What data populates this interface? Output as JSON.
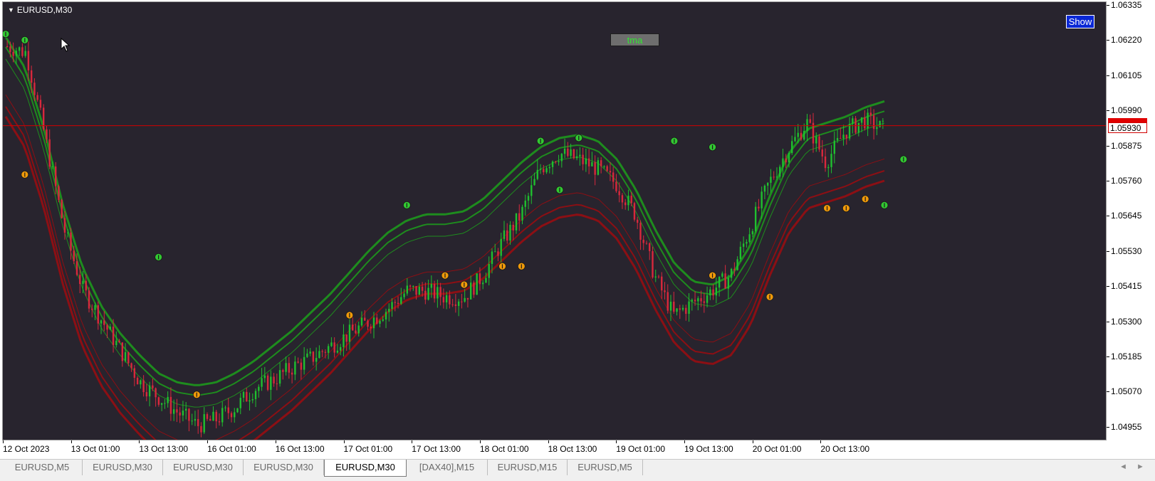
{
  "chart": {
    "symbol": "EURUSD,M30",
    "buttons": {
      "tma": "tma",
      "show": "Show"
    },
    "bid_price": "1.05930",
    "price_labels": [
      "1.06335",
      "1.06220",
      "1.06105",
      "1.05990",
      "1.05875",
      "1.05760",
      "1.05645",
      "1.05530",
      "1.05415",
      "1.05300",
      "1.05185",
      "1.05070",
      "1.04955"
    ],
    "time_labels": [
      "12 Oct 2023",
      "13 Oct 01:00",
      "13 Oct 13:00",
      "16 Oct 01:00",
      "16 Oct 13:00",
      "17 Oct 01:00",
      "17 Oct 13:00",
      "18 Oct 01:00",
      "18 Oct 13:00",
      "19 Oct 01:00",
      "19 Oct 13:00",
      "20 Oct 01:00",
      "20 Oct 13:00"
    ],
    "colors": {
      "background": "#28242e",
      "bull_candle": "#1fbf2f",
      "bear_candle": "#d8283c",
      "upper_band": "#1e8c1e",
      "lower_band": "#8c0f14",
      "bid_line": "#d10000",
      "up_signal": "#32c832",
      "down_signal": "#f09a0a"
    }
  },
  "chart_data": {
    "type": "candlestick",
    "title": "",
    "ylim": [
      1.049,
      1.064
    ],
    "x_categories": [
      "12 Oct 2023",
      "13 Oct 01:00",
      "13 Oct 13:00",
      "16 Oct 01:00",
      "16 Oct 13:00",
      "17 Oct 01:00",
      "17 Oct 13:00",
      "18 Oct 01:00",
      "18 Oct 13:00",
      "19 Oct 01:00",
      "19 Oct 13:00",
      "20 Oct 01:00",
      "20 Oct 13:00"
    ],
    "close_path": [
      1.062,
      1.0618,
      1.059,
      1.056,
      1.054,
      1.053,
      1.052,
      1.051,
      1.0505,
      1.05,
      1.0496,
      1.0498,
      1.0502,
      1.0508,
      1.0511,
      1.0515,
      1.0518,
      1.0522,
      1.0526,
      1.053,
      1.0534,
      1.054,
      1.054,
      1.0538,
      1.0538,
      1.0545,
      1.0556,
      1.0565,
      1.058,
      1.0585,
      1.0583,
      1.058,
      1.0575,
      1.0565,
      1.0545,
      1.0532,
      1.0536,
      1.054,
      1.0545,
      1.056,
      1.0575,
      1.0586,
      1.0595,
      1.0582,
      1.0592,
      1.0596,
      1.0593
    ],
    "tma_mid": [
      1.061,
      1.06,
      1.058,
      1.0555,
      1.0535,
      1.0522,
      1.0513,
      1.0506,
      1.05,
      1.0497,
      1.0496,
      1.0497,
      1.05,
      1.0504,
      1.0509,
      1.0514,
      1.052,
      1.0526,
      1.0533,
      1.054,
      1.0546,
      1.055,
      1.0552,
      1.0552,
      1.0553,
      1.0557,
      1.0563,
      1.0569,
      1.0574,
      1.0577,
      1.0578,
      1.0576,
      1.057,
      1.056,
      1.0547,
      1.0536,
      1.053,
      1.0529,
      1.0532,
      1.0542,
      1.0558,
      1.0572,
      1.058,
      1.0582,
      1.0584,
      1.0587,
      1.0589
    ],
    "band_offset": 0.0013,
    "up_signals": [
      [
        0,
        1.0624
      ],
      [
        1,
        1.0622
      ],
      [
        8,
        1.0551
      ],
      [
        21,
        1.0568
      ],
      [
        28,
        1.0589
      ],
      [
        29,
        1.0573
      ],
      [
        30,
        1.059
      ],
      [
        35,
        1.0589
      ],
      [
        37,
        1.0587
      ],
      [
        46,
        1.0568
      ],
      [
        47,
        1.0583
      ]
    ],
    "down_signals": [
      [
        1,
        1.0578
      ],
      [
        10,
        1.0506
      ],
      [
        18,
        1.0532
      ],
      [
        23,
        1.0545
      ],
      [
        24,
        1.0542
      ],
      [
        26,
        1.0548
      ],
      [
        27,
        1.0548
      ],
      [
        37,
        1.0545
      ],
      [
        40,
        1.0538
      ],
      [
        43,
        1.0567
      ],
      [
        44,
        1.0567
      ],
      [
        45,
        1.057
      ]
    ],
    "bid_line": 1.0594
  },
  "tabs": [
    {
      "label": "EURUSD,M5",
      "active": false
    },
    {
      "label": "EURUSD,M30",
      "active": false
    },
    {
      "label": "EURUSD,M30",
      "active": false
    },
    {
      "label": "EURUSD,M30",
      "active": false
    },
    {
      "label": "EURUSD,M30",
      "active": true
    },
    {
      "label": "[DAX40],M15",
      "active": false
    },
    {
      "label": "EURUSD,M15",
      "active": false
    },
    {
      "label": "EURUSD,M5",
      "active": false
    }
  ],
  "nav": {
    "left": "◄",
    "right": "►"
  }
}
